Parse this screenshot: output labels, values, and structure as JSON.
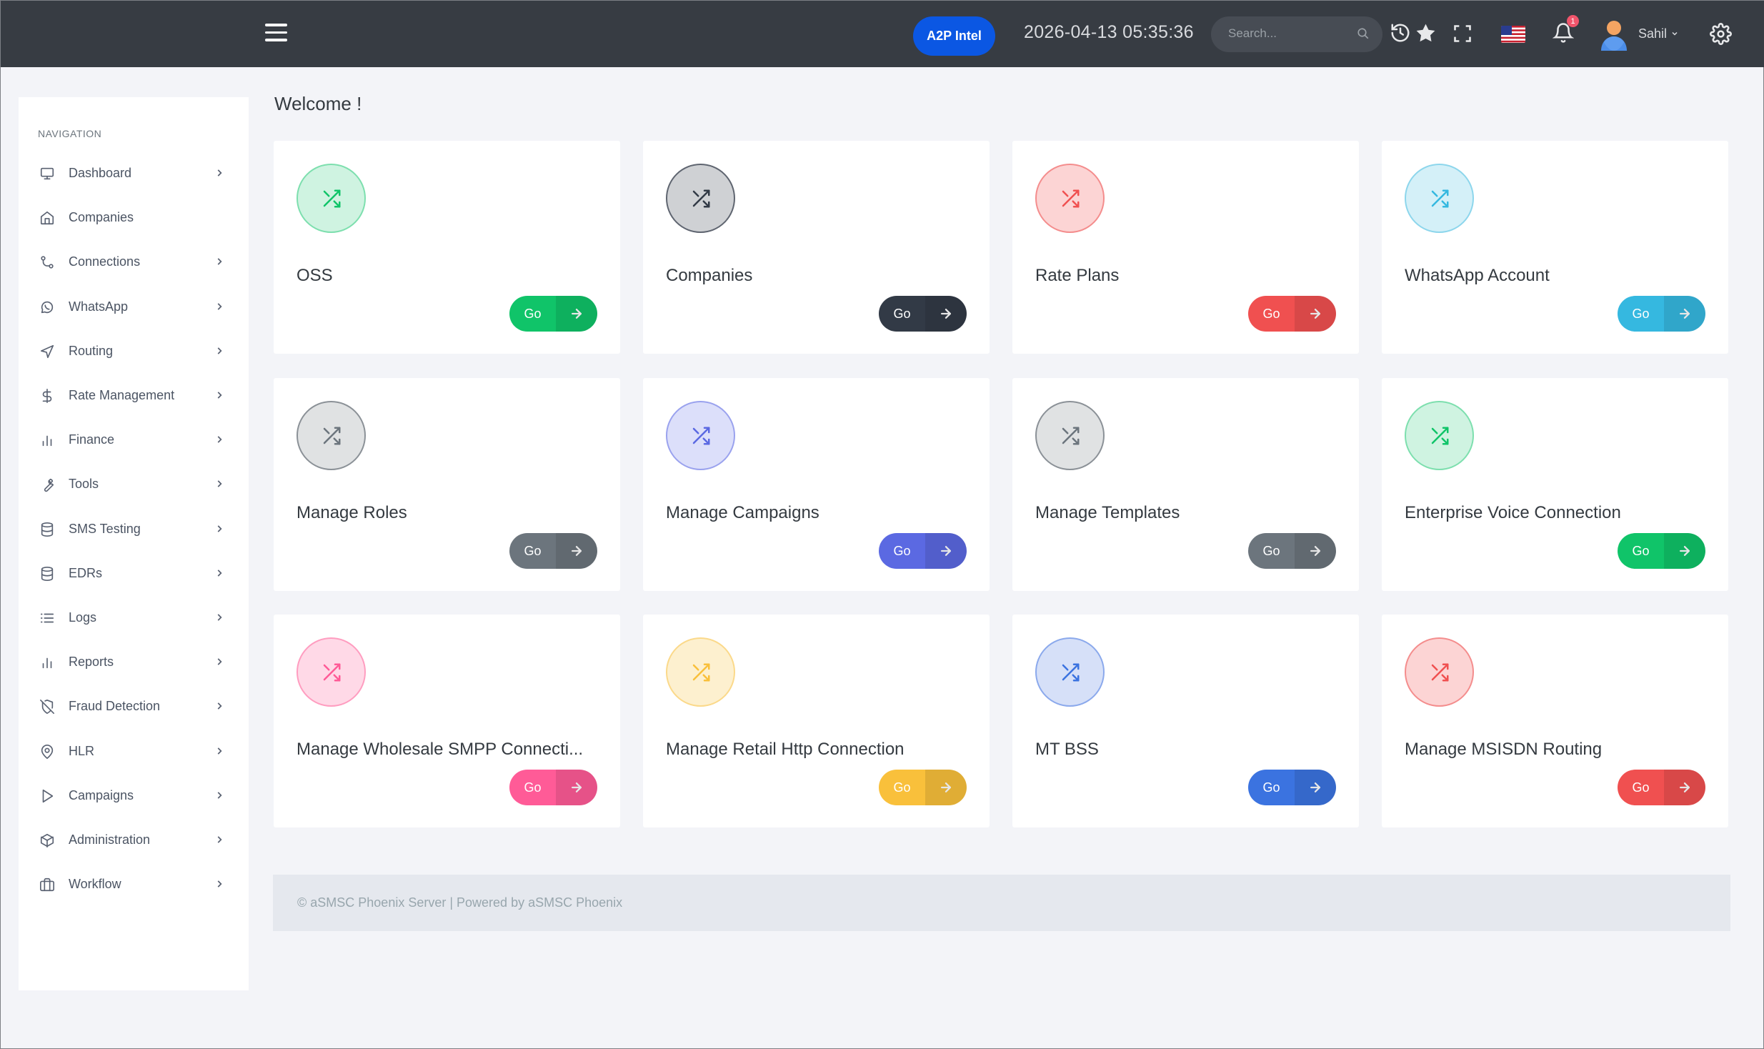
{
  "topbar": {
    "badge_label": "A2P Intel",
    "datetime": "2026-04-13 05:35:36",
    "search_placeholder": "Search...",
    "notification_count": "1",
    "username": "Sahil",
    "colors": {
      "bg": "#373c43",
      "badge": "#0b57e3"
    }
  },
  "sidebar": {
    "title": "NAVIGATION",
    "items": [
      {
        "label": "Dashboard",
        "icon": "monitor-icon",
        "chevron": true
      },
      {
        "label": "Companies",
        "icon": "home-icon",
        "chevron": false
      },
      {
        "label": "Connections",
        "icon": "git-commit-icon",
        "chevron": true
      },
      {
        "label": "WhatsApp",
        "icon": "whatsapp-icon",
        "chevron": true
      },
      {
        "label": "Routing",
        "icon": "navigation-icon",
        "chevron": true
      },
      {
        "label": "Rate Management",
        "icon": "dollar-icon",
        "chevron": true
      },
      {
        "label": "Finance",
        "icon": "bar-chart-icon",
        "chevron": true
      },
      {
        "label": "Tools",
        "icon": "wrench-icon",
        "chevron": true
      },
      {
        "label": "SMS Testing",
        "icon": "database-icon",
        "chevron": true
      },
      {
        "label": "EDRs",
        "icon": "database-icon",
        "chevron": true
      },
      {
        "label": "Logs",
        "icon": "list-icon",
        "chevron": true
      },
      {
        "label": "Reports",
        "icon": "bar-chart-icon",
        "chevron": true
      },
      {
        "label": "Fraud Detection",
        "icon": "shield-off-icon",
        "chevron": true
      },
      {
        "label": "HLR",
        "icon": "map-pin-icon",
        "chevron": true
      },
      {
        "label": "Campaigns",
        "icon": "play-icon",
        "chevron": true
      },
      {
        "label": "Administration",
        "icon": "package-icon",
        "chevron": true
      },
      {
        "label": "Workflow",
        "icon": "briefcase-icon",
        "chevron": true
      }
    ]
  },
  "main": {
    "welcome": "Welcome !",
    "cards": [
      {
        "title": "OSS",
        "go": "Go",
        "color": "#10c469",
        "light": "#cff3e1",
        "border": "#7ddfae"
      },
      {
        "title": "Companies",
        "go": "Go",
        "color": "#323a46",
        "light": "#cfd1d4",
        "border": "#5f6570"
      },
      {
        "title": "Rate Plans",
        "go": "Go",
        "color": "#f05050",
        "light": "#fcd4d4",
        "border": "#f48d8d"
      },
      {
        "title": "WhatsApp Account",
        "go": "Go",
        "color": "#35b8e0",
        "light": "#d4f0f8",
        "border": "#8dd6ec"
      },
      {
        "title": "Manage Roles",
        "go": "Go",
        "color": "#6c757d",
        "light": "#e0e2e3",
        "border": "#8b9197"
      },
      {
        "title": "Manage Campaigns",
        "go": "Go",
        "color": "#5b69e2",
        "light": "#dcdffa",
        "border": "#9aa2ee"
      },
      {
        "title": "Manage Templates",
        "go": "Go",
        "color": "#6c757d",
        "light": "#e0e2e3",
        "border": "#8b9197"
      },
      {
        "title": "Enterprise Voice Connection",
        "go": "Go",
        "color": "#10c469",
        "light": "#cff3e1",
        "border": "#7ddfae"
      },
      {
        "title": "Manage Wholesale SMPP Connecti...",
        "go": "Go",
        "color": "#ff5b97",
        "light": "#ffd9e7",
        "border": "#ff9dc0"
      },
      {
        "title": "Manage Retail Http Connection",
        "go": "Go",
        "color": "#f9c03b",
        "light": "#fdf0cf",
        "border": "#fbd98a"
      },
      {
        "title": "MT BSS",
        "go": "Go",
        "color": "#3b73e0",
        "light": "#d6e0f8",
        "border": "#8ba9ec"
      },
      {
        "title": "Manage MSISDN Routing",
        "go": "Go",
        "color": "#f05050",
        "light": "#fcd4d4",
        "border": "#f48d8d"
      }
    ]
  },
  "footer": {
    "text": "© aSMSC Phoenix Server | Powered by aSMSC Phoenix"
  }
}
